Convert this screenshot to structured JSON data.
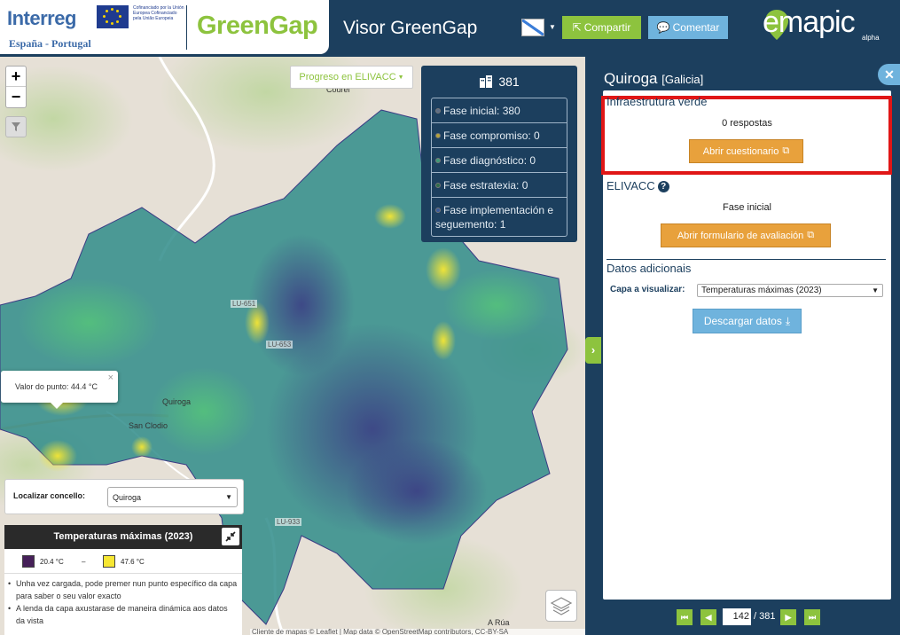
{
  "header": {
    "interreg": "Interreg",
    "interreg_sub": "España - Portugal",
    "eu_text": "Cofinanciado por la Unión Europea Cofinanciado pela União Europeia",
    "project_logo": "GreenGap",
    "app_title": "Visor GreenGap",
    "language_flag_icon": "galician-flag-icon",
    "share_label": "Compartir",
    "comment_label": "Comentar",
    "brand": "emapic",
    "brand_tag": "alpha"
  },
  "map": {
    "progress_button": "Progreso en ELIVACC",
    "places": {
      "courel": "Courel",
      "quiroga": "Quiroga",
      "san_clodio": "San Clodio",
      "a_rua": "A Rúa"
    },
    "roads": [
      "LU-651",
      "LU-653",
      "LU-933"
    ],
    "phase_summary": {
      "total": "381",
      "icon": "buildings-icon",
      "items": [
        {
          "label": "Fase inicial: 380",
          "color": "#5e6f87"
        },
        {
          "label": "Fase compromiso: 0",
          "color": "#b5a33a"
        },
        {
          "label": "Fase diagnóstico: 0",
          "color": "#3f9a78"
        },
        {
          "label": "Fase estratexia: 0",
          "color": "#2f6e4a"
        },
        {
          "label": "Fase implementación e seguemento: 1",
          "color": "#3a5b9a"
        }
      ]
    },
    "popup": {
      "text": "Valor do punto: 44.4 °C",
      "close": "×"
    },
    "locate": {
      "label": "Localizar concello:",
      "value": "Quiroga"
    },
    "legend": {
      "title": "Temperaturas máximas (2023)",
      "min_label": "20.4 °C",
      "dash": "–",
      "max_label": "47.6 °C",
      "min_color": "#462059",
      "max_color": "#f7e733",
      "notes": [
        "Unha vez cargada, pode premer nun punto específico da capa para saber o seu valor exacto",
        "A lenda da capa axustarase de maneira dinámica aos datos da vista"
      ]
    },
    "attribution": "Cliente de mapas © Leaflet | Map data © OpenStreetMap contributors, CC-BY-SA"
  },
  "panel": {
    "title": "Quiroga",
    "region": "[Galicia]",
    "green_infra": {
      "title": "Infraestrutura verde",
      "responses": "0 respostas",
      "button": "Abrir cuestionario"
    },
    "elivacc": {
      "title": "ELIVACC",
      "phase": "Fase inicial",
      "button": "Abrir formulario de avaliación"
    },
    "extra": {
      "title": "Datos adicionais",
      "layer_label": "Capa a visualizar:",
      "layer_value": "Temperaturas máximas (2023)",
      "download": "Descargar datos"
    },
    "pager": {
      "current": "142",
      "total": "/ 381"
    }
  },
  "colors": {
    "navy": "#1c3f5e",
    "green": "#8dc33e",
    "light_blue": "#6fb3dd",
    "orange": "#e8a13c",
    "highlight": "#e01616"
  }
}
